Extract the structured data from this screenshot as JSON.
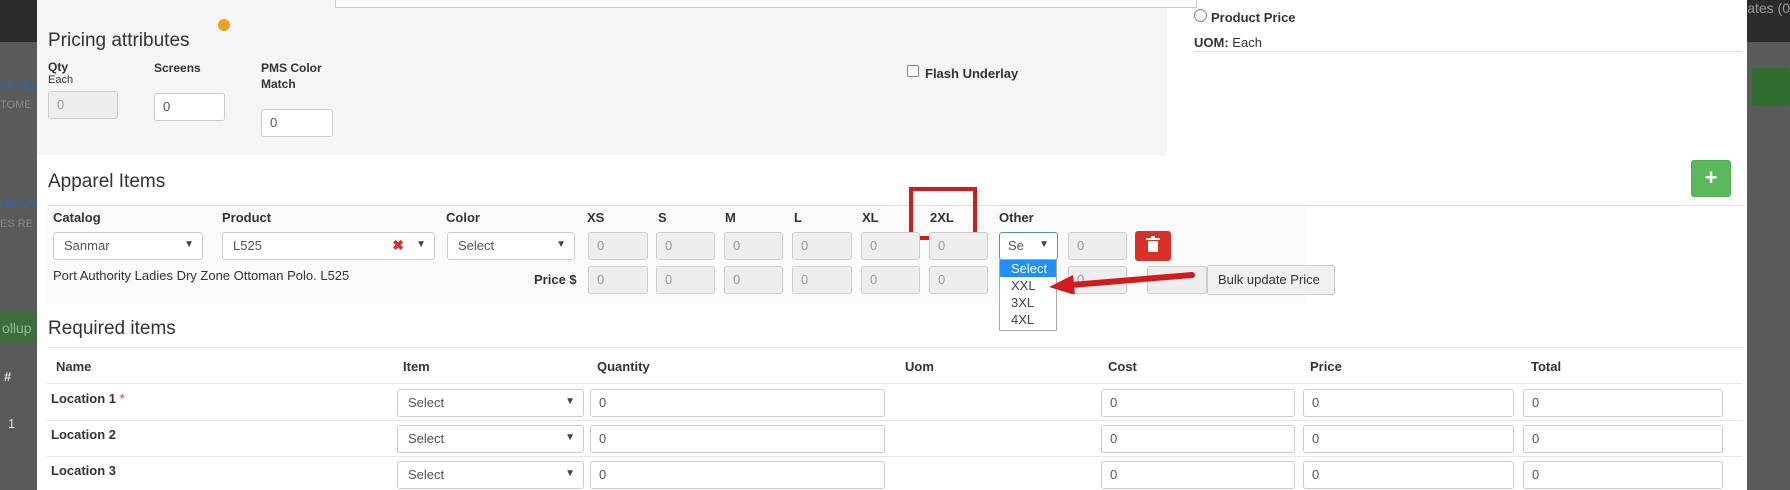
{
  "backdrop": {
    "left_texts": [
      "ck qu",
      "TOME",
      "ron A",
      "ES RE",
      "#",
      "1"
    ],
    "left_green": "ollup",
    "right_text": "ates (0"
  },
  "pricing": {
    "title": "Pricing attributes",
    "qty_label": "Qty",
    "qty_sub": "Each",
    "qty_value": "0",
    "screens_label": "Screens",
    "screens_value": "0",
    "pms_label": "PMS Color Match",
    "pms_value": "0",
    "flash_label": "Flash Underlay",
    "product_price_label": "Product Price",
    "uom_label": "UOM:",
    "uom_value": "Each"
  },
  "apparel": {
    "title": "Apparel Items",
    "add_icon": "plus-icon",
    "headers": {
      "catalog": "Catalog",
      "product": "Product",
      "color": "Color",
      "xs": "XS",
      "s": "S",
      "m": "M",
      "l": "L",
      "xl": "XL",
      "xxl": "2XL",
      "other": "Other"
    },
    "catalog_value": "Sanmar",
    "product_value": "L525",
    "color_value": "Select",
    "product_desc": "Port Authority Ladies Dry Zone Ottoman Polo. L525",
    "qty_values": [
      "0",
      "0",
      "0",
      "0",
      "0",
      "0"
    ],
    "other_select_value": "Se",
    "other_qty": "0",
    "price_label": "Price $",
    "price_values": [
      "0",
      "0",
      "0",
      "0",
      "0",
      "0"
    ],
    "other_price_partial": "0",
    "bulk_update_label": "Bulk update Price",
    "other_options": [
      "Select",
      "XXL",
      "3XL",
      "4XL"
    ],
    "highlight_color": "#d21c1c",
    "arrow_color": "#d21c1c"
  },
  "required": {
    "title": "Required items",
    "columns": {
      "name": "Name",
      "item": "Item",
      "quantity": "Quantity",
      "uom": "Uom",
      "cost": "Cost",
      "price": "Price",
      "total": "Total"
    },
    "rows": [
      {
        "name": "Location 1",
        "required_mark": "*",
        "item": "Select",
        "quantity": "0",
        "cost": "0",
        "price": "0",
        "total": "0"
      },
      {
        "name": "Location 2",
        "required_mark": "",
        "item": "Select",
        "quantity": "0",
        "cost": "0",
        "price": "0",
        "total": "0"
      },
      {
        "name": "Location 3",
        "required_mark": "",
        "item": "Select",
        "quantity": "0",
        "cost": "0",
        "price": "0",
        "total": "0"
      }
    ]
  }
}
